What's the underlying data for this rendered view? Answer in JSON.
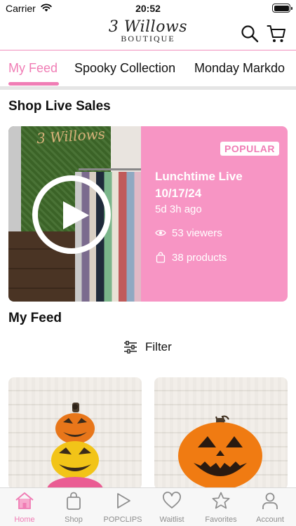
{
  "status_bar": {
    "carrier": "Carrier",
    "time": "20:52"
  },
  "header": {
    "logo_script": "3 Willows",
    "logo_sub": "BOUTIQUE",
    "search_icon": "search-icon",
    "cart_icon": "cart-icon"
  },
  "tabs": [
    {
      "label": "My Feed",
      "active": true
    },
    {
      "label": "Spooky Collection",
      "active": false
    },
    {
      "label": "Monday Markdo",
      "active": false
    }
  ],
  "live_section": {
    "title": "Shop Live Sales",
    "card": {
      "badge": "POPULAR",
      "title": "Lunchtime Live 10/17/24",
      "ago": "5d 3h ago",
      "viewers": "53 viewers",
      "products": "38 products",
      "photo_sign": "3 Willows"
    }
  },
  "feed_section": {
    "title": "My Feed",
    "filter_label": "Filter",
    "items": [
      {
        "description": "stacked pumpkin jack-o-lantern"
      },
      {
        "description": "orange jack-o-lantern"
      }
    ]
  },
  "tabbar": [
    {
      "label": "Home",
      "icon": "home-icon",
      "active": true
    },
    {
      "label": "Shop",
      "icon": "bag-icon",
      "active": false
    },
    {
      "label": "POPCLIPS",
      "icon": "play-icon",
      "active": false
    },
    {
      "label": "Waitlist",
      "icon": "heart-icon",
      "active": false
    },
    {
      "label": "Favorites",
      "icon": "star-icon",
      "active": false
    },
    {
      "label": "Account",
      "icon": "person-icon",
      "active": false
    }
  ],
  "colors": {
    "accent": "#f07db5",
    "card_pink": "#f795c4",
    "divider": "#e5e5e5"
  }
}
